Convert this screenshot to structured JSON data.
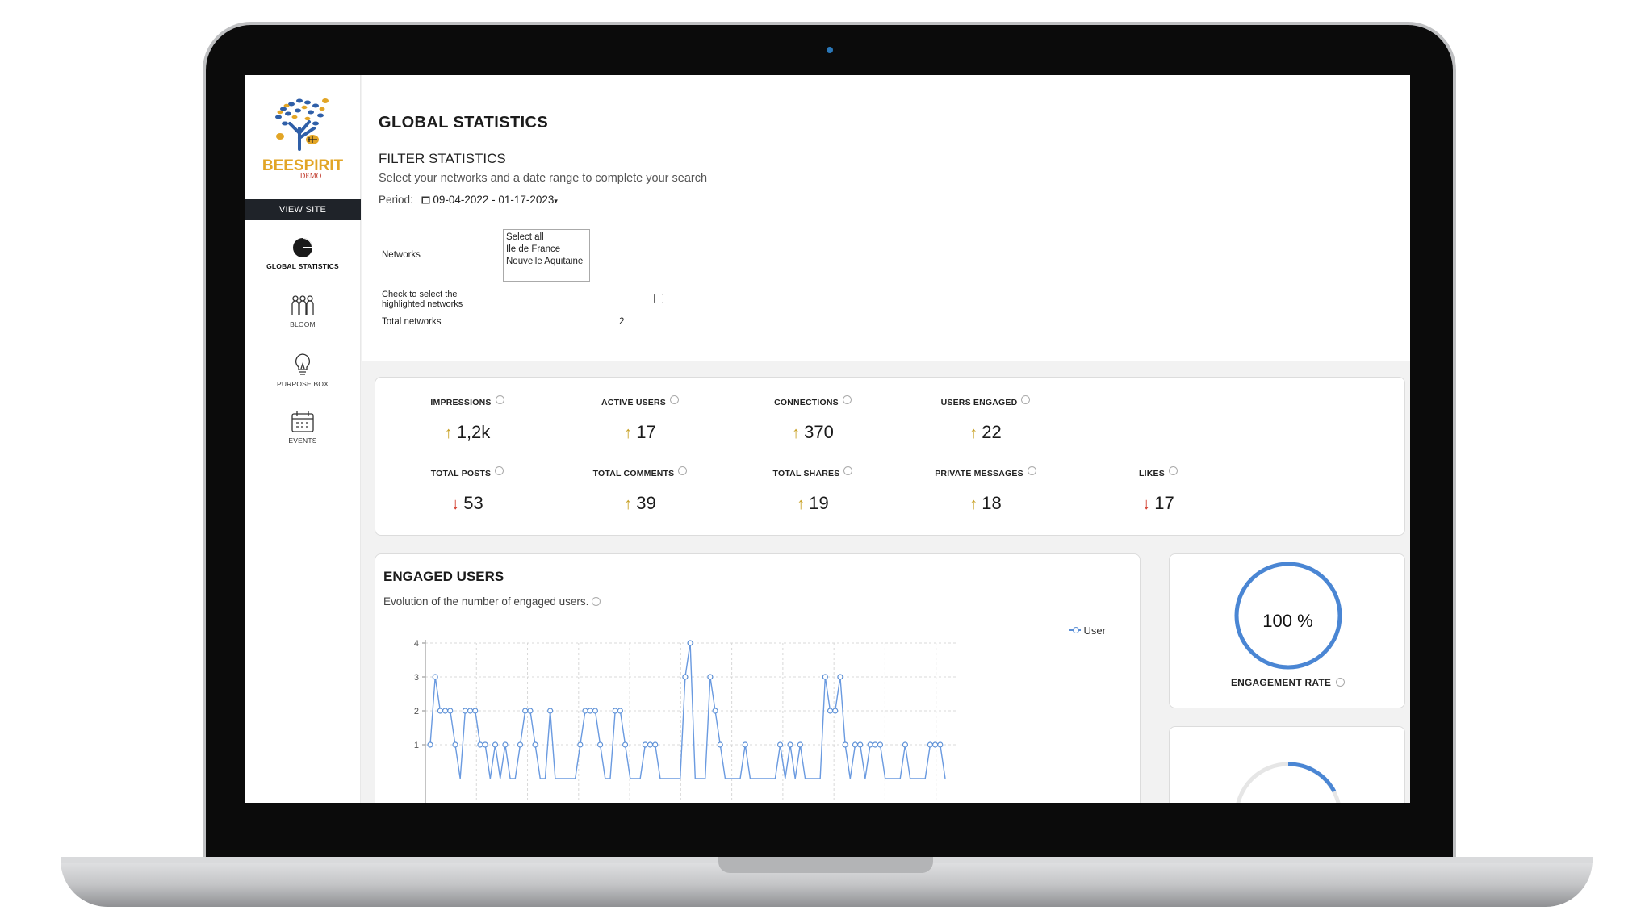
{
  "app": {
    "brand": "BEESPIRIT",
    "brand_sub": "DEMO",
    "view_site": "VIEW SITE"
  },
  "sidebar": {
    "items": [
      {
        "label": "GLOBAL STATISTICS",
        "icon": "pie-chart-icon",
        "active": true
      },
      {
        "label": "BLOOM",
        "icon": "people-icon",
        "active": false
      },
      {
        "label": "PURPOSE BOX",
        "icon": "lightbulb-icon",
        "active": false
      },
      {
        "label": "EVENTS",
        "icon": "calendar-icon",
        "active": false
      }
    ]
  },
  "header": {
    "title": "GLOBAL STATISTICS"
  },
  "filter": {
    "title": "FILTER STATISTICS",
    "subtitle": "Select your networks and a date range to complete your search",
    "period_label": "Period:",
    "period_value": "09-04-2022 - 01-17-2023",
    "networks_label": "Networks",
    "network_options": [
      "Select all",
      "Ile de France",
      "Nouvelle Aquitaine"
    ],
    "check_label": "Check to select the highlighted networks",
    "total_label": "Total networks",
    "total_value": "2"
  },
  "kpis": [
    {
      "label": "IMPRESSIONS",
      "value": "1,2k",
      "trend": "up"
    },
    {
      "label": "ACTIVE USERS",
      "value": "17",
      "trend": "up"
    },
    {
      "label": "CONNECTIONS",
      "value": "370",
      "trend": "up"
    },
    {
      "label": "USERS ENGAGED",
      "value": "22",
      "trend": "up"
    },
    {
      "label": "TOTAL POSTS",
      "value": "53",
      "trend": "down"
    },
    {
      "label": "TOTAL COMMENTS",
      "value": "39",
      "trend": "up"
    },
    {
      "label": "TOTAL SHARES",
      "value": "19",
      "trend": "up"
    },
    {
      "label": "PRIVATE MESSAGES",
      "value": "18",
      "trend": "up"
    },
    {
      "label": "LIKES",
      "value": "17",
      "trend": "down"
    }
  ],
  "engaged": {
    "title": "ENGAGED USERS",
    "subtitle": "Evolution of the number of engaged users."
  },
  "engagement_rate": {
    "value": "100 %",
    "label": "ENGAGEMENT RATE",
    "fraction": 1.0
  },
  "colors": {
    "accent": "#5b8fd6",
    "up_arrow": "#c9a227",
    "down_arrow": "#d23a2a",
    "sidebar_button": "#1f2329"
  },
  "chart_data": {
    "type": "line",
    "series": [
      {
        "name": "User",
        "values": [
          1,
          3,
          2,
          2,
          2,
          1,
          0,
          2,
          2,
          2,
          1,
          1,
          0,
          1,
          0,
          1,
          0,
          0,
          1,
          2,
          2,
          1,
          0,
          0,
          2,
          0,
          0,
          0,
          0,
          0,
          1,
          2,
          2,
          2,
          1,
          0,
          0,
          2,
          2,
          1,
          0,
          0,
          0,
          1,
          1,
          1,
          0,
          0,
          0,
          0,
          0,
          3,
          4,
          0,
          0,
          0,
          3,
          2,
          1,
          0,
          0,
          0,
          0,
          1,
          0,
          0,
          0,
          0,
          0,
          0,
          1,
          0,
          1,
          0,
          1,
          0,
          0,
          0,
          0,
          3,
          2,
          2,
          3,
          1,
          0,
          1,
          1,
          0,
          1,
          1,
          1,
          0,
          0,
          0,
          0,
          1,
          0,
          0,
          0,
          0,
          1,
          1,
          1,
          0
        ]
      }
    ],
    "ylim": [
      0,
      4
    ],
    "yticks": [
      1,
      2,
      3,
      4
    ],
    "grid": true,
    "legend": "top-right"
  }
}
